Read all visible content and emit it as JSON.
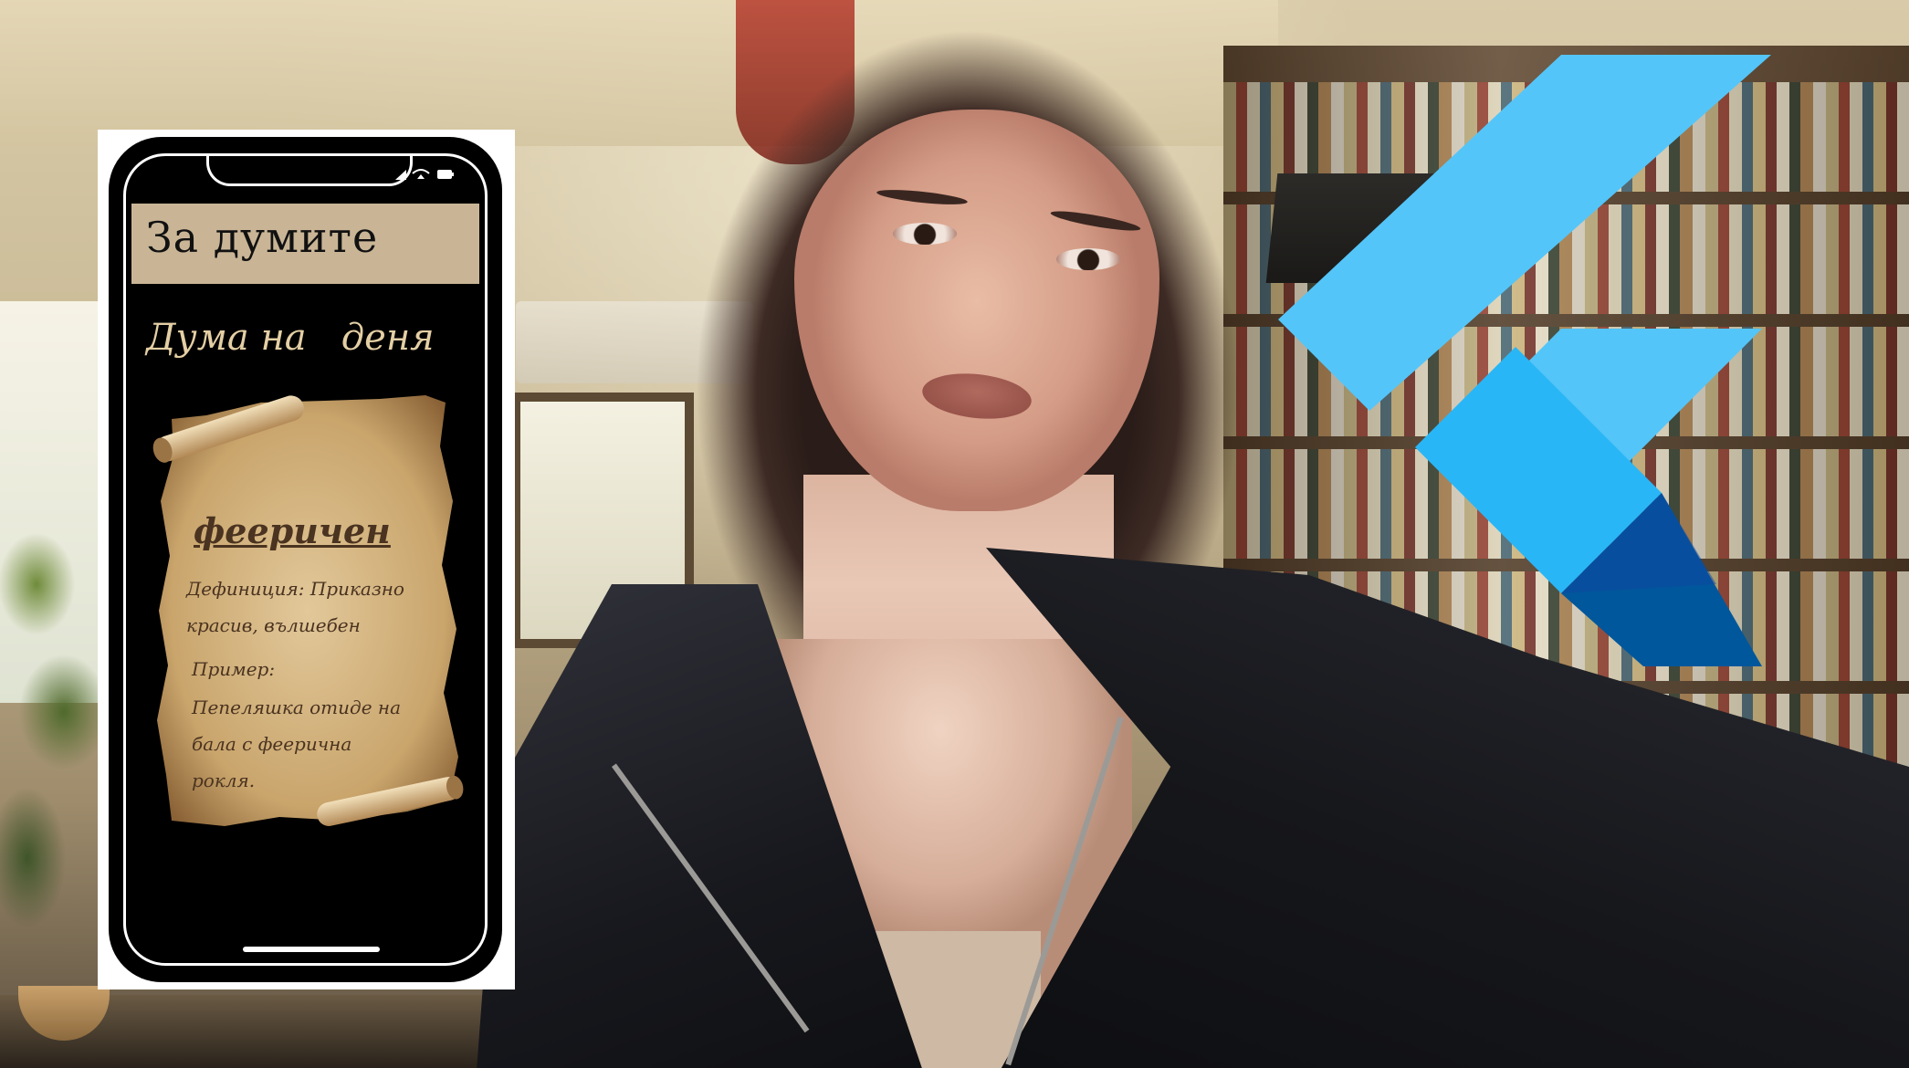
{
  "app": {
    "title": "За думите",
    "heading": "Дума на   деня"
  },
  "word_of_day": {
    "word": "фееричен",
    "definition": "Дефиниция: Приказно красив, вълшебен",
    "example_label": "Пример:",
    "example_text": "Пепеляшка отиде на бала с феерична рокля."
  },
  "colors": {
    "app_bar": "#c9b596",
    "heading_text": "#e4cfa4",
    "scroll_ink": "#4a3320",
    "flutter_light": "#54c5f8",
    "flutter_mid": "#29b6f6",
    "flutter_dark": "#01579b"
  },
  "icons": [
    "signal-icon",
    "wifi-icon",
    "battery-icon",
    "flutter-logo"
  ]
}
